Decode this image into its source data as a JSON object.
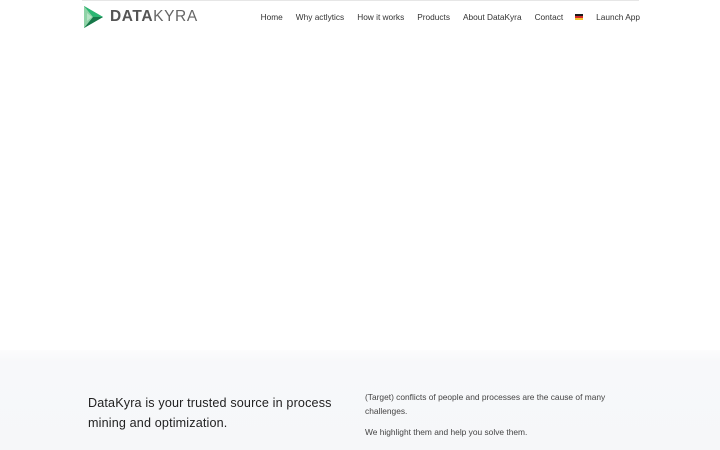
{
  "brand": {
    "name_part1": "DATA",
    "name_part2": "KYRA",
    "logo_colors": [
      "#2bb673",
      "#1f8f55",
      "#8fd3a7"
    ]
  },
  "nav": {
    "items": [
      {
        "label": "Home"
      },
      {
        "label": "Why actlytics"
      },
      {
        "label": "How it works"
      },
      {
        "label": "Products"
      },
      {
        "label": "About DataKyra"
      },
      {
        "label": "Contact"
      }
    ],
    "language_flag": "de-flag-icon",
    "launch_label": "Launch App"
  },
  "intro": {
    "headline": "DataKyra is your trusted source in process mining and optimization.",
    "paragraph_1": "(Target) conflicts of people and processes are the cause of many challenges.",
    "paragraph_2": "We highlight them and help you solve them."
  }
}
